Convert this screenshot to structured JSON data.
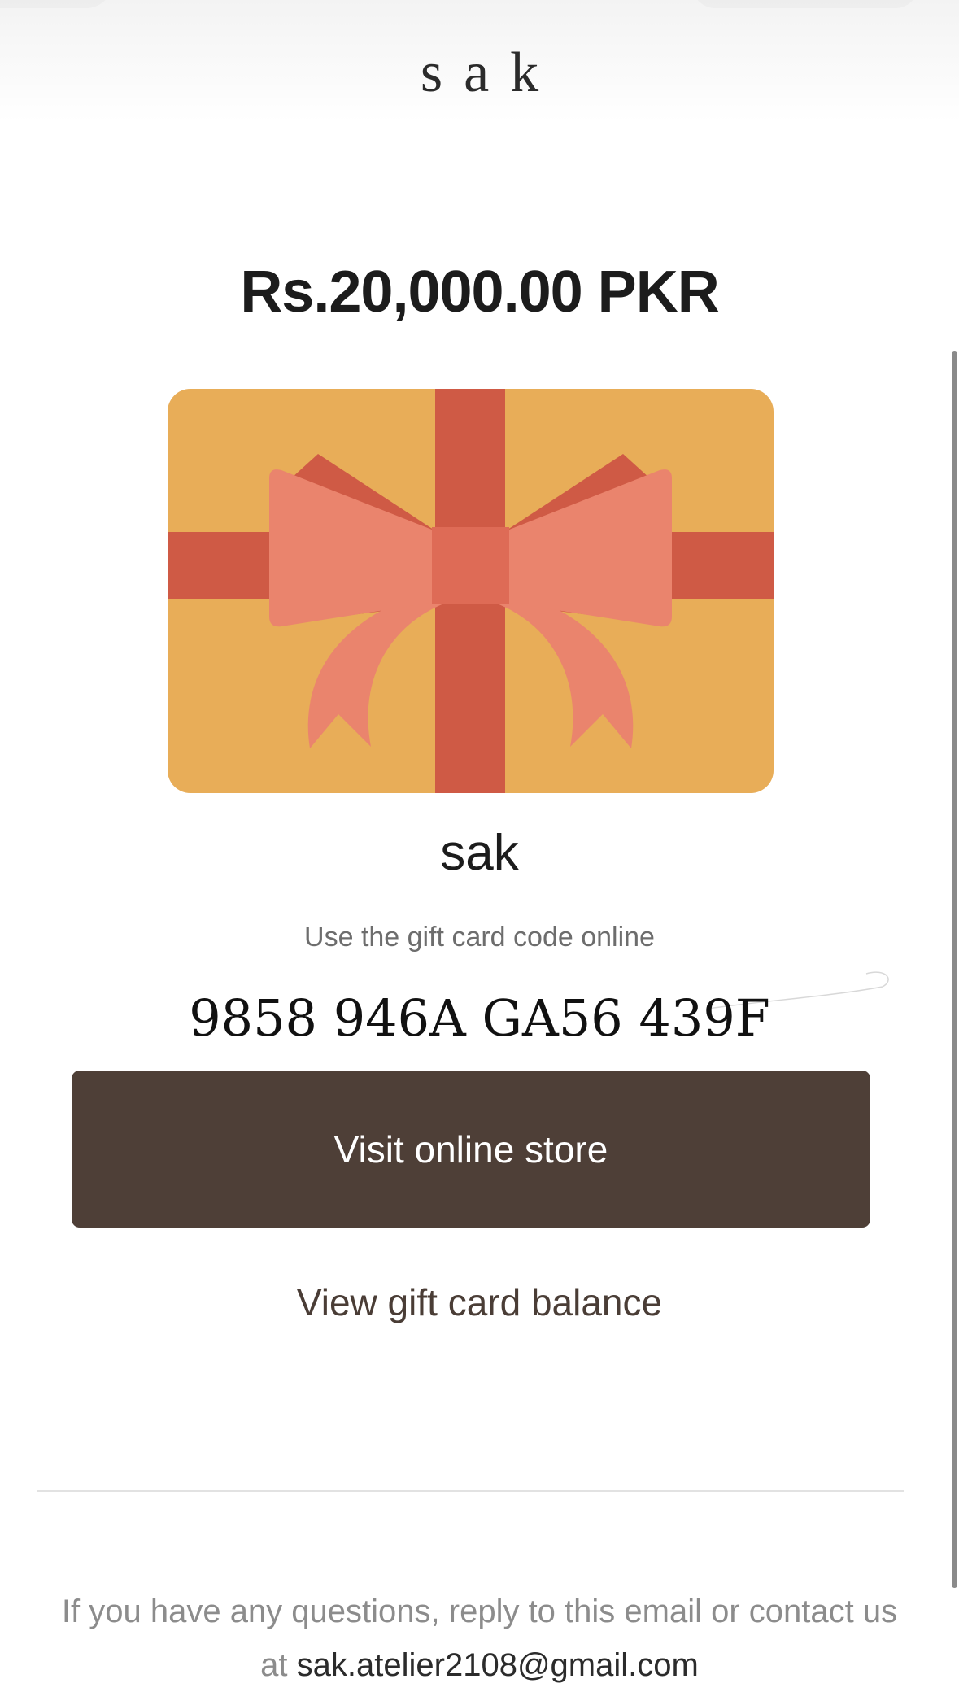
{
  "header": {
    "logo_text": "sak"
  },
  "gift_card": {
    "amount": "Rs.20,000.00 PKR",
    "store_name": "sak",
    "code_hint": "Use the gift card code online",
    "code": "9858 946A GA56 439F",
    "colors": {
      "card_background": "#E8AD58",
      "ribbon": "#CF5A45",
      "bow": "#EA846D",
      "bow_knot": "#DE6B56"
    }
  },
  "actions": {
    "visit_store_label": "Visit online store",
    "view_balance_label": "View gift card balance",
    "button_color": "#4E3F37"
  },
  "footer": {
    "text": "If you have any questions, reply to this email or contact us at ",
    "email": "sak.atelier2108@gmail.com"
  }
}
